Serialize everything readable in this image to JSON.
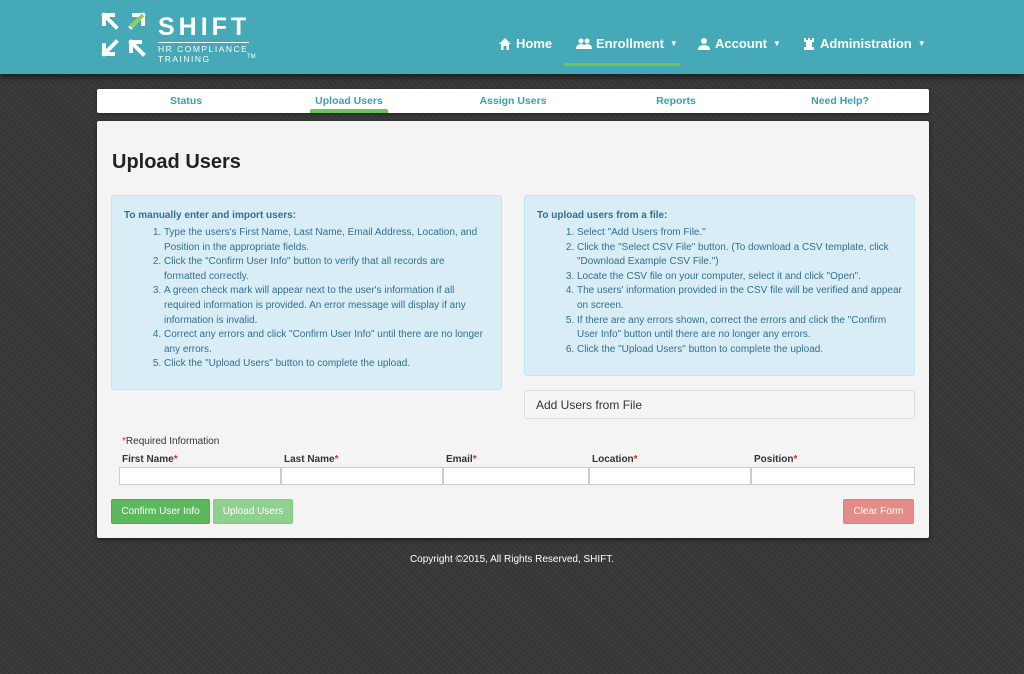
{
  "brand": {
    "name": "SHIFT",
    "subtitle_line1": "HR COMPLIANCE",
    "subtitle_line2": "TRAINING",
    "trademark": "TM"
  },
  "colors": {
    "header": "#45a9b8",
    "accent_green": "#6fc35b",
    "info_bg": "#d9edf7",
    "info_text": "#31708f",
    "danger": "#e48c8a"
  },
  "nav": {
    "home": {
      "label": "Home",
      "icon": "home-icon"
    },
    "enrollment": {
      "label": "Enrollment",
      "icon": "users-icon",
      "active": true
    },
    "account": {
      "label": "Account",
      "icon": "user-icon"
    },
    "administration": {
      "label": "Administration",
      "icon": "rook-icon"
    }
  },
  "subnav": {
    "tabs": [
      "Status",
      "Upload Users",
      "Assign Users",
      "Reports",
      "Need Help?"
    ],
    "active": "Upload Users"
  },
  "page": {
    "title": "Upload Users"
  },
  "manual": {
    "heading": "To manually enter and import users:",
    "steps": [
      "Type the users's First Name, Last Name, Email Address, Location, and Position in the appropriate fields.",
      "Click the \"Confirm User Info\" button to verify that all records are formatted correctly.",
      "A green check mark will appear next to the user's information if all required information is provided. An error message will display if any information is invalid.",
      "Correct any errors and click \"Confirm User Info\" until there are no longer any errors.",
      "Click the \"Upload Users\" button to complete the upload."
    ]
  },
  "file_upload": {
    "heading": "To upload users from a file:",
    "steps": [
      "Select \"Add Users from File.\"",
      "Click the \"Select CSV File\" button. (To download a CSV template, click \"Download Example CSV File.\")",
      "Locate the CSV file on your computer, select it and click \"Open\".",
      "The users' information provided in the CSV file will be verified and appear on screen.",
      "If there are any errors shown, correct the errors and click the \"Confirm User Info\" button until there are no longer any errors.",
      "Click the \"Upload Users\" button to complete the upload."
    ],
    "add_users_label": "Add Users from File"
  },
  "form": {
    "required_label": "Required Information",
    "required_marker": "*",
    "columns": [
      "First Name",
      "Last Name",
      "Email",
      "Location",
      "Position"
    ]
  },
  "buttons": {
    "confirm": "Confirm User Info",
    "upload": "Upload Users",
    "clear": "Clear Form"
  },
  "footer": {
    "copyright": "Copyright ©2015, All Rights Reserved, SHIFT."
  }
}
